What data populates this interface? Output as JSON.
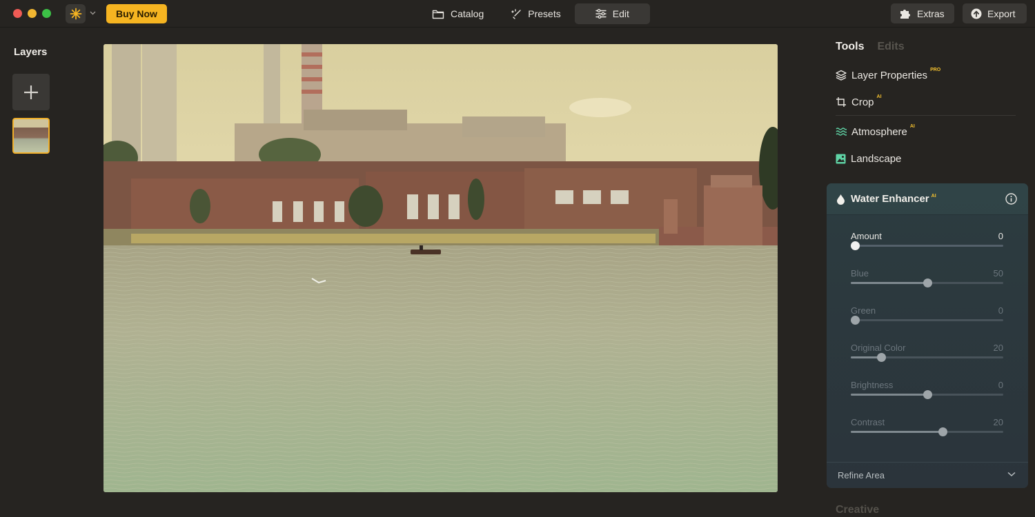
{
  "topbar": {
    "buy_now_label": "Buy Now",
    "tabs": [
      {
        "label": "Catalog",
        "icon": "folder-icon"
      },
      {
        "label": "Presets",
        "icon": "sparkle-icon"
      },
      {
        "label": "Edit",
        "icon": "sliders-icon",
        "active": true
      }
    ],
    "extras_label": "Extras",
    "export_label": "Export",
    "accent_color": "#f5b421"
  },
  "layers": {
    "title": "Layers"
  },
  "panel": {
    "tabs": [
      {
        "label": "Tools",
        "active": true
      },
      {
        "label": "Edits",
        "active": false
      }
    ],
    "tools": [
      {
        "label": "Layer Properties",
        "badge": "PRO",
        "icon": "layers-icon"
      },
      {
        "label": "Crop",
        "badge": "AI",
        "icon": "crop-icon"
      },
      {
        "label": "Atmosphere",
        "badge": "AI",
        "icon": "waves-icon"
      },
      {
        "label": "Landscape",
        "badge": "",
        "icon": "image-icon"
      }
    ],
    "water_enhancer": {
      "title": "Water Enhancer",
      "badge": "AI",
      "sliders": [
        {
          "label": "Amount",
          "value": "0",
          "fraction": 0.0,
          "active": true
        },
        {
          "label": "Blue",
          "value": "50",
          "fraction": 0.5,
          "active": false
        },
        {
          "label": "Green",
          "value": "0",
          "fraction": 0.0,
          "active": false
        },
        {
          "label": "Original Color",
          "value": "20",
          "fraction": 0.2,
          "active": false
        },
        {
          "label": "Brightness",
          "value": "0",
          "fraction": 0.5,
          "active": false
        },
        {
          "label": "Contrast",
          "value": "20",
          "fraction": 0.6,
          "active": false
        }
      ],
      "refine_label": "Refine Area"
    },
    "creative_label": "Creative"
  }
}
